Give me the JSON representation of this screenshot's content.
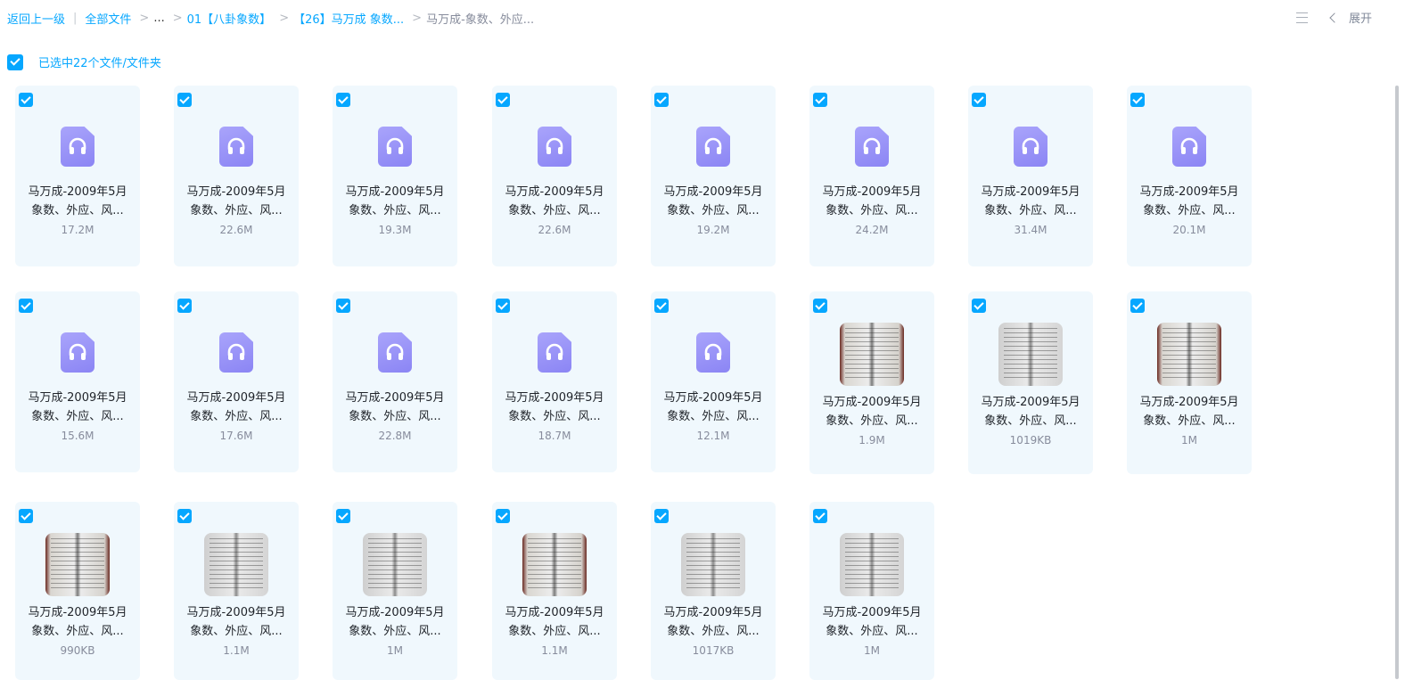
{
  "breadcrumb": {
    "back": "返回上一级",
    "all_files": "全部文件",
    "ellipsis": "...",
    "level1": "01【八卦象数】",
    "level2": "【26】马万成 象数...",
    "current": "马万成-象数、外应..."
  },
  "toolbar": {
    "expand_label": "展开",
    "list_icon": "list-view-icon"
  },
  "selection": {
    "label": "已选中22个文件/文件夹"
  },
  "colors": {
    "accent": "#06a7ff",
    "audio_icon": "#8b85f4",
    "card_bg": "#f0f8fd"
  },
  "files": [
    {
      "line1": "马万成-2009年5月",
      "line2": "象数、外应、风...",
      "size": "17.2M",
      "kind": "audio"
    },
    {
      "line1": "马万成-2009年5月",
      "line2": "象数、外应、风...",
      "size": "22.6M",
      "kind": "audio"
    },
    {
      "line1": "马万成-2009年5月",
      "line2": "象数、外应、风...",
      "size": "19.3M",
      "kind": "audio"
    },
    {
      "line1": "马万成-2009年5月",
      "line2": "象数、外应、风...",
      "size": "22.6M",
      "kind": "audio"
    },
    {
      "line1": "马万成-2009年5月",
      "line2": "象数、外应、风...",
      "size": "19.2M",
      "kind": "audio"
    },
    {
      "line1": "马万成-2009年5月",
      "line2": "象数、外应、风...",
      "size": "24.2M",
      "kind": "audio"
    },
    {
      "line1": "马万成-2009年5月",
      "line2": "象数、外应、风...",
      "size": "31.4M",
      "kind": "audio"
    },
    {
      "line1": "马万成-2009年5月",
      "line2": "象数、外应、风...",
      "size": "20.1M",
      "kind": "audio"
    },
    {
      "line1": "马万成-2009年5月",
      "line2": "象数、外应、风...",
      "size": "15.6M",
      "kind": "audio"
    },
    {
      "line1": "马万成-2009年5月",
      "line2": "象数、外应、风...",
      "size": "17.6M",
      "kind": "audio"
    },
    {
      "line1": "马万成-2009年5月",
      "line2": "象数、外应、风...",
      "size": "22.8M",
      "kind": "audio"
    },
    {
      "line1": "马万成-2009年5月",
      "line2": "象数、外应、风...",
      "size": "18.7M",
      "kind": "audio"
    },
    {
      "line1": "马万成-2009年5月",
      "line2": "象数、外应、风...",
      "size": "12.1M",
      "kind": "audio"
    },
    {
      "line1": "马万成-2009年5月",
      "line2": "象数、外应、风...",
      "size": "1.9M",
      "kind": "image"
    },
    {
      "line1": "马万成-2009年5月",
      "line2": "象数、外应、风...",
      "size": "1019KB",
      "kind": "image"
    },
    {
      "line1": "马万成-2009年5月",
      "line2": "象数、外应、风...",
      "size": "1M",
      "kind": "image"
    },
    {
      "line1": "马万成-2009年5月",
      "line2": "象数、外应、风...",
      "size": "990KB",
      "kind": "image"
    },
    {
      "line1": "马万成-2009年5月",
      "line2": "象数、外应、风...",
      "size": "1.1M",
      "kind": "image"
    },
    {
      "line1": "马万成-2009年5月",
      "line2": "象数、外应、风...",
      "size": "1M",
      "kind": "image"
    },
    {
      "line1": "马万成-2009年5月",
      "line2": "象数、外应、风...",
      "size": "1.1M",
      "kind": "image"
    },
    {
      "line1": "马万成-2009年5月",
      "line2": "象数、外应、风...",
      "size": "1017KB",
      "kind": "image"
    },
    {
      "line1": "马万成-2009年5月",
      "line2": "象数、外应、风...",
      "size": "1M",
      "kind": "image"
    }
  ]
}
